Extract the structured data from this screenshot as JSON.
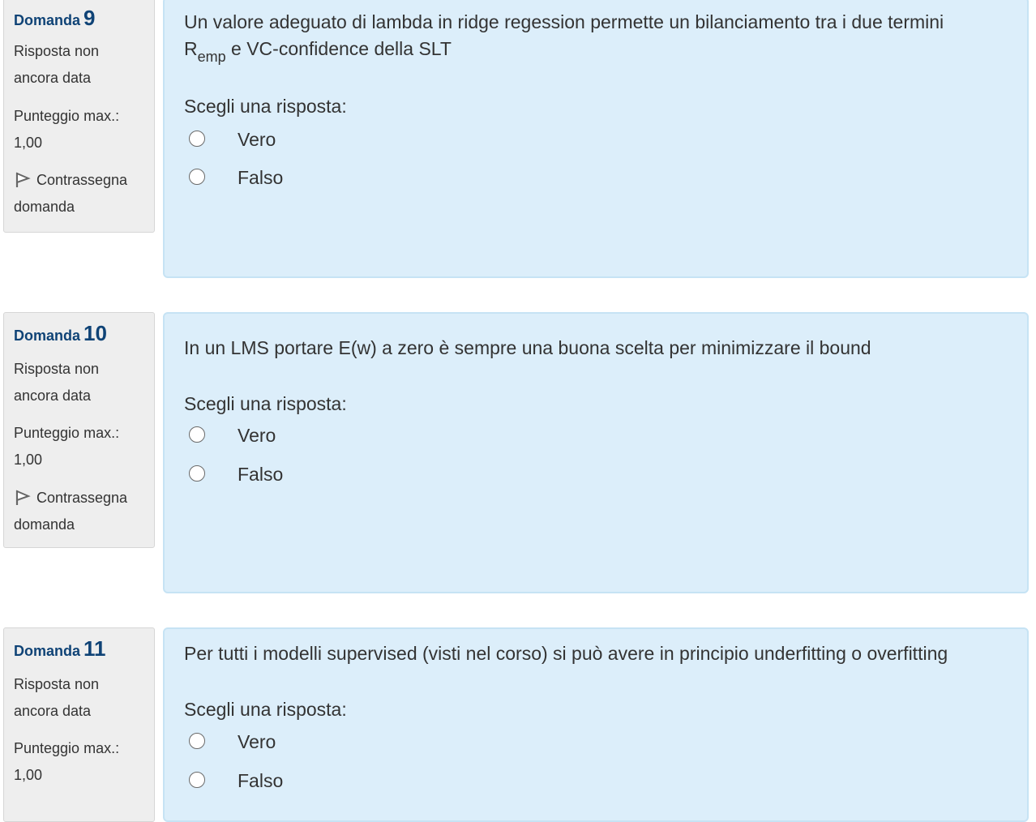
{
  "questions": [
    {
      "label": "Domanda",
      "number": "9",
      "state_line1": "Risposta non",
      "state_line2": "ancora data",
      "grade_line1": "Punteggio max.:",
      "grade_line2": "1,00",
      "flag_line1": "Contrassegna",
      "flag_line2": "domanda",
      "text_part1": "Un valore adeguato di lambda  in ridge regession   permette un bilanciamento tra i due termini",
      "text_r": "R",
      "text_sub": "emp",
      "text_part2": " e  VC-confidence della SLT",
      "prompt": "Scegli una risposta:",
      "options": [
        "Vero",
        "Falso"
      ]
    },
    {
      "label": "Domanda",
      "number": "10",
      "state_line1": "Risposta non",
      "state_line2": "ancora data",
      "grade_line1": "Punteggio max.:",
      "grade_line2": "1,00",
      "flag_line1": "Contrassegna",
      "flag_line2": "domanda",
      "text": "In un LMS portare E(w) a zero è sempre  una buona scelta per minimizzare il bound",
      "prompt": "Scegli una risposta:",
      "options": [
        "Vero",
        "Falso"
      ]
    },
    {
      "label": "Domanda",
      "number": "11",
      "state_line1": "Risposta non",
      "state_line2": "ancora data",
      "grade_line1": "Punteggio max.:",
      "grade_line2": "1,00",
      "text": "Per tutti i modelli supervised (visti nel corso) si può avere in principio underfitting o overfitting",
      "prompt": "Scegli una risposta:",
      "options": [
        "Vero",
        "Falso"
      ]
    }
  ],
  "colors": {
    "qno": "#0f4376",
    "info_bg": "#eeeeee",
    "content_bg": "#dceefa",
    "content_border": "#c6e3f4"
  },
  "icons": {
    "flag": "flag-icon",
    "radio": "radio-icon"
  }
}
